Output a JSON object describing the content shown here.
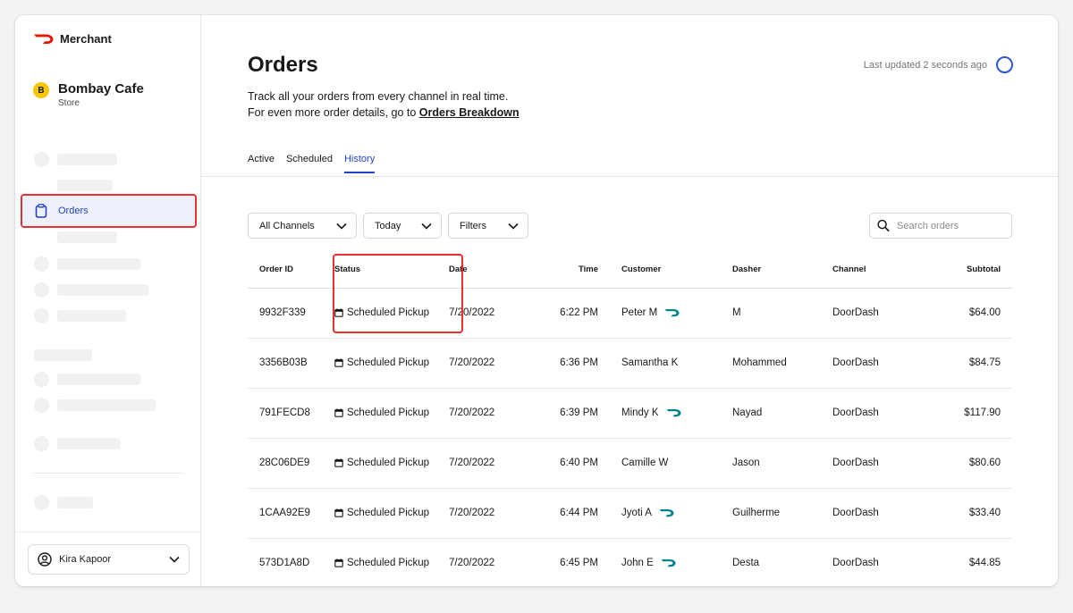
{
  "sidebar": {
    "brand": "Merchant",
    "store": {
      "badge": "B",
      "name": "Bombay Cafe",
      "sub": "Store"
    },
    "nav_orders": "Orders",
    "user": "Kira Kapoor"
  },
  "header": {
    "title": "Orders",
    "desc_line1": "Track all your orders from every channel in real time.",
    "desc_line2_prefix": "For even more order details, go to ",
    "desc_link": "Orders Breakdown",
    "updated": "Last updated 2 seconds ago"
  },
  "tabs": [
    "Active",
    "Scheduled",
    "History"
  ],
  "filters": {
    "channels": "All Channels",
    "date": "Today",
    "filters": "Filters"
  },
  "search": {
    "placeholder": "Search orders"
  },
  "table": {
    "headers": [
      "Order ID",
      "Status",
      "Date",
      "Time",
      "Customer",
      "Dasher",
      "Channel",
      "Subtotal"
    ],
    "rows": [
      [
        "9932F339",
        "Scheduled Pickup",
        "7/20/2022",
        "6:22 PM",
        "Peter M",
        "M",
        "DoorDash",
        "$64.00"
      ],
      [
        "3356B03B",
        "Scheduled Pickup",
        "7/20/2022",
        "6:36 PM",
        "Samantha K",
        "Mohammed",
        "DoorDash",
        "$84.75"
      ],
      [
        "791FECD8",
        "Scheduled Pickup",
        "7/20/2022",
        "6:39 PM",
        "Mindy K",
        "Nayad",
        "DoorDash",
        "$117.90"
      ],
      [
        "28C06DE9",
        "Scheduled Pickup",
        "7/20/2022",
        "6:40 PM",
        "Camille W",
        "Jason",
        "DoorDash",
        "$80.60"
      ],
      [
        "1CAA92E9",
        "Scheduled Pickup",
        "7/20/2022",
        "6:44 PM",
        "Jyoti A",
        "Guilherme",
        "DoorDash",
        "$33.40"
      ],
      [
        "573D1A8D",
        "Scheduled Pickup",
        "7/20/2022",
        "6:45 PM",
        "John E",
        "Desta",
        "DoorDash",
        "$44.85"
      ]
    ]
  },
  "colors": {
    "accent": "#2243c9",
    "brand": "#eb1700",
    "highlight": "#e8302c",
    "dashpass": "#00838a"
  }
}
